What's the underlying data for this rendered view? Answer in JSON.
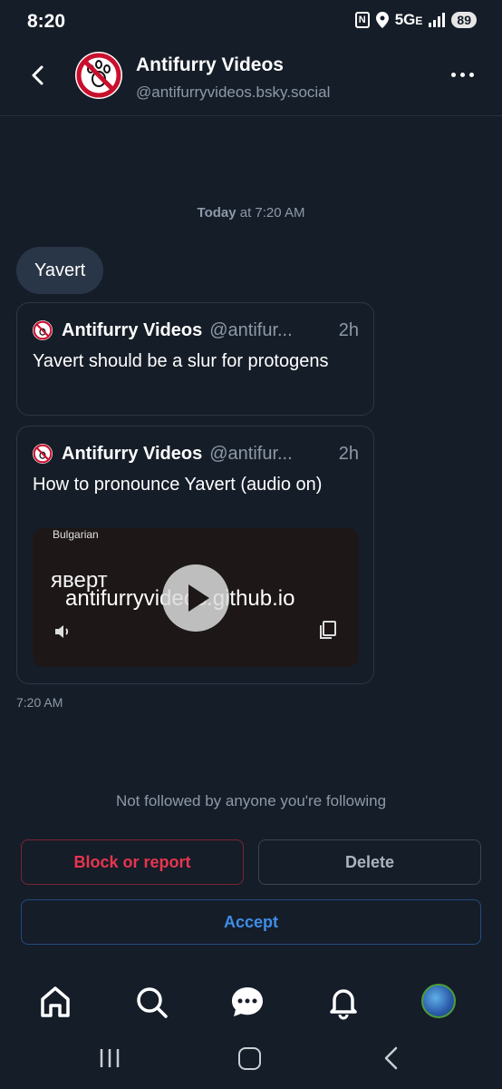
{
  "status_bar": {
    "time": "8:20",
    "network": "5G",
    "network_suffix": "E",
    "battery": "89"
  },
  "header": {
    "title": "Antifurry Videos",
    "handle": "@antifurryvideos.bsky.social"
  },
  "conversation": {
    "date_bold": "Today",
    "date_rest": " at 7:20 AM",
    "message_text": "Yavert",
    "message_time": "7:20 AM",
    "embeds": [
      {
        "author": "Antifurry Videos",
        "handle": "@antifur...",
        "age": "2h",
        "text": "Yavert should be a slur for protogens"
      },
      {
        "author": "Antifurry Videos",
        "handle": "@antifur...",
        "age": "2h",
        "text": "How to pronounce Yavert (audio on)",
        "video": {
          "language": "Bulgarian",
          "cyrillic": "яверт",
          "url_overlay": "antifurryvideos.github.io"
        }
      }
    ]
  },
  "request": {
    "note": "Not followed by anyone you're following",
    "block_label": "Block or report",
    "delete_label": "Delete",
    "accept_label": "Accept"
  },
  "nav": [
    "home-icon",
    "search-icon",
    "chat-icon",
    "bell-icon",
    "profile-avatar"
  ],
  "colors": {
    "background": "#151d28",
    "accent": "#3f8de8",
    "danger": "#e8354f"
  }
}
